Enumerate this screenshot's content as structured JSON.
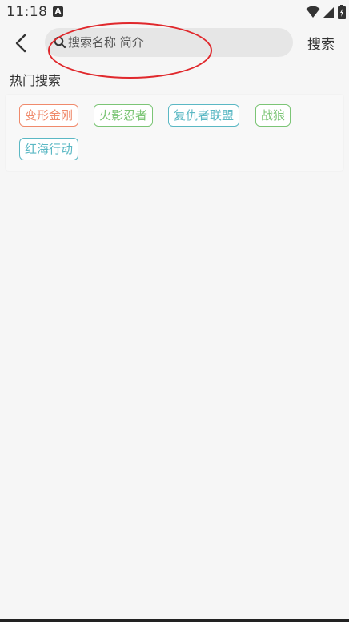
{
  "status_bar": {
    "time": "11:18",
    "notification_icon_letter": "A"
  },
  "header": {
    "search_placeholder": "搜索名称 简介",
    "search_value": "",
    "search_button_label": "搜索"
  },
  "hot_search": {
    "title": "热门搜索",
    "tags": [
      {
        "label": "变形金刚",
        "color": "#f08a6c"
      },
      {
        "label": "火影忍者",
        "color": "#7cc576"
      },
      {
        "label": "复仇者联盟",
        "color": "#5bb8c4"
      },
      {
        "label": "战狼",
        "color": "#7cc576"
      },
      {
        "label": "红海行动",
        "color": "#5bb8c4"
      }
    ]
  },
  "colors": {
    "background": "#f6f6f6",
    "search_box": "#e6e6e6",
    "annotation": "#e0282c"
  }
}
